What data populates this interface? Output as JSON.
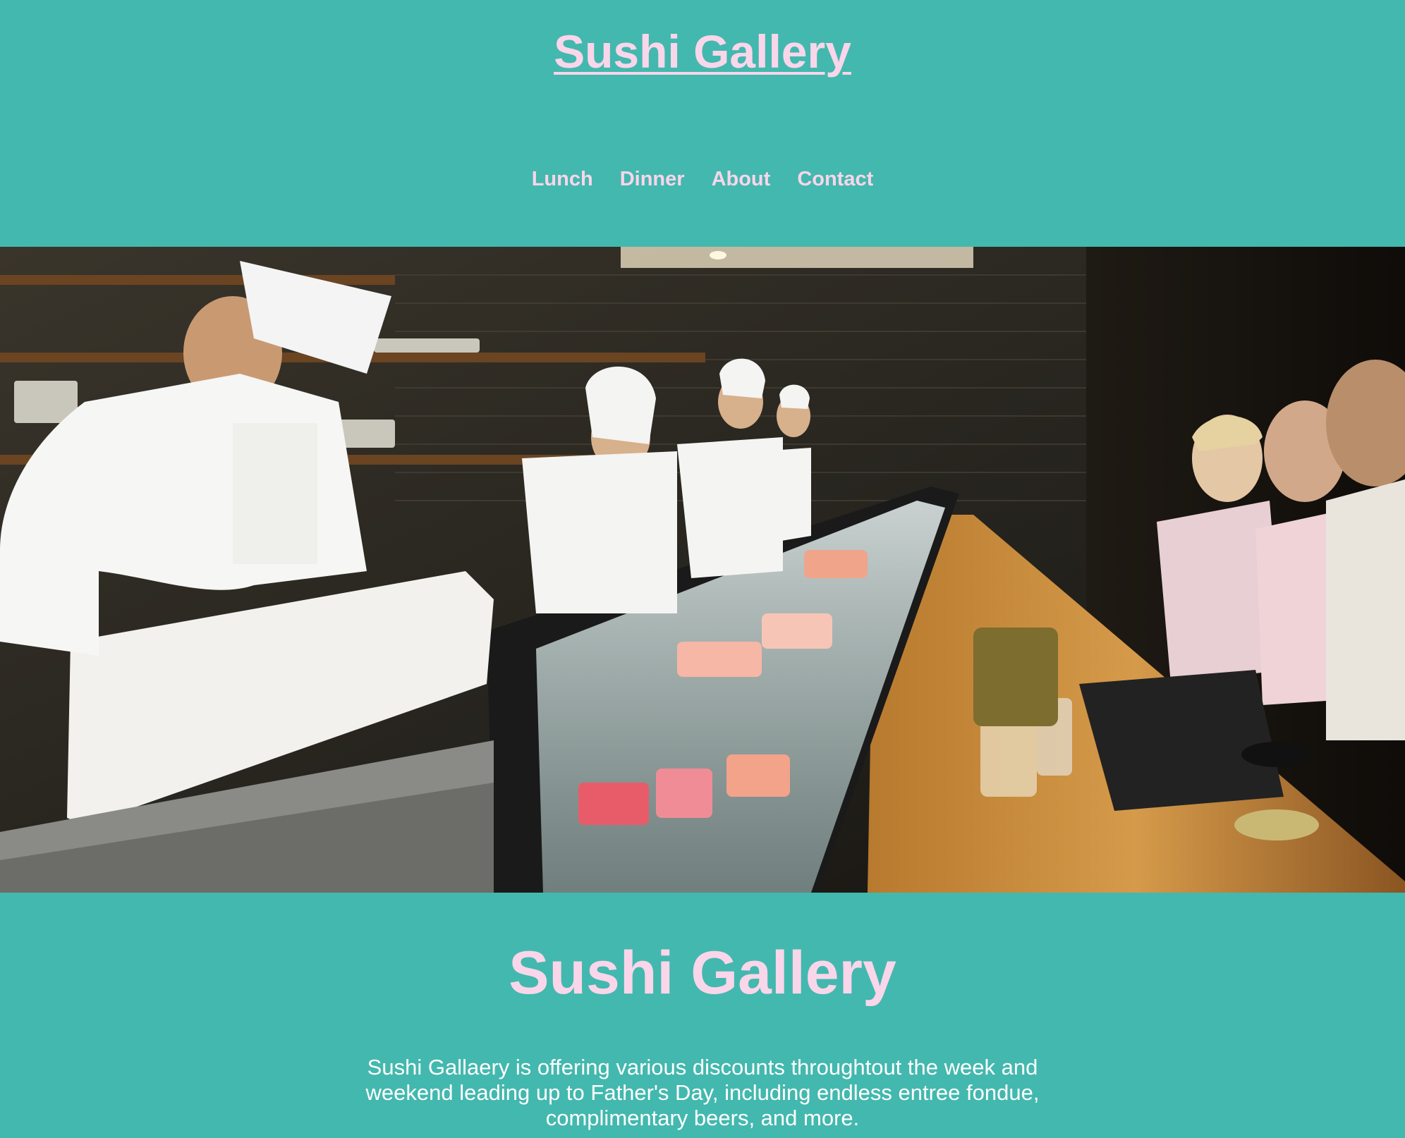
{
  "header": {
    "title": "Sushi Gallery"
  },
  "nav": {
    "items": [
      {
        "label": "Lunch"
      },
      {
        "label": "Dinner"
      },
      {
        "label": "About"
      },
      {
        "label": "Contact"
      }
    ]
  },
  "hero": {
    "image_icon": "sushi-bar-photo"
  },
  "main": {
    "heading": "Sushi Gallery",
    "description": "Sushi Gallaery is offering various discounts throughtout the week and weekend leading up to Father's Day, including endless entree fondue, complimentary beers, and more."
  },
  "colors": {
    "background": "#43b8ae",
    "accent_pink": "#f9d6ea",
    "body_text": "#ffffff"
  }
}
